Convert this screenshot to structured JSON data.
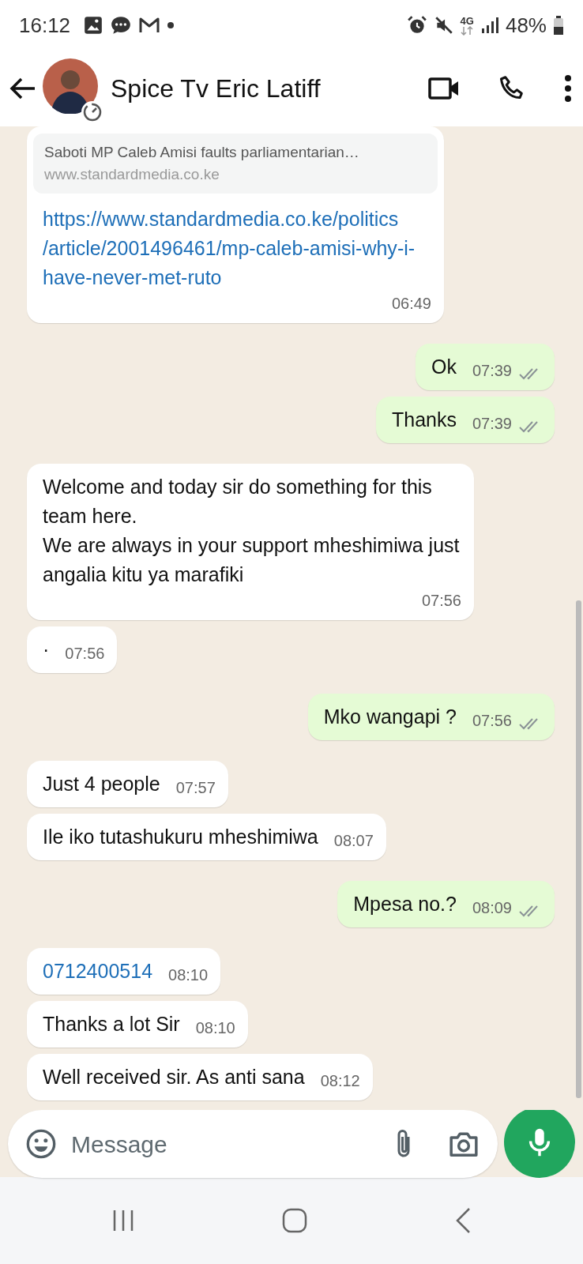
{
  "status_bar": {
    "time": "16:12",
    "network": "4G",
    "battery": "48%"
  },
  "header": {
    "contact_name": "Spice Tv Eric Latiff"
  },
  "messages": [
    {
      "kind": "link",
      "outgoing": false,
      "preview_description": "Saboti MP Caleb Amisi faults parliamentarian…",
      "preview_domain": "www.standardmedia.co.ke",
      "text": "https://www.standardmedia.co.ke/politics/article/2001496461/mp-caleb-amisi-why-i-have-never-met-ruto",
      "time": "06:49"
    },
    {
      "kind": "text",
      "outgoing": true,
      "text": "Ok",
      "time": "07:39",
      "read": false
    },
    {
      "kind": "text",
      "outgoing": true,
      "text": "Thanks",
      "time": "07:39",
      "read": false
    },
    {
      "kind": "text",
      "outgoing": false,
      "text": "Welcome and today sir do something for this team here.\nWe are always in your support mheshimiwa just angalia kitu ya marafiki",
      "time": "07:56"
    },
    {
      "kind": "text",
      "outgoing": false,
      "text": "·",
      "time": "07:56"
    },
    {
      "kind": "text",
      "outgoing": true,
      "text": "Mko wangapi ?",
      "time": "07:56",
      "read": false
    },
    {
      "kind": "text",
      "outgoing": false,
      "text": "Just 4 people",
      "time": "07:57"
    },
    {
      "kind": "text",
      "outgoing": false,
      "text": "Ile iko tutashukuru mheshimiwa",
      "time": "08:07"
    },
    {
      "kind": "text",
      "outgoing": true,
      "text": "Mpesa no.?",
      "time": "08:09",
      "read": false
    },
    {
      "kind": "phone",
      "outgoing": false,
      "text": "0712400514",
      "time": "08:10"
    },
    {
      "kind": "text",
      "outgoing": false,
      "text": "Thanks a lot Sir",
      "time": "08:10"
    },
    {
      "kind": "text",
      "outgoing": false,
      "text": "Well received sir. As anti sana",
      "time": "08:12"
    }
  ],
  "composer": {
    "placeholder": "Message"
  }
}
